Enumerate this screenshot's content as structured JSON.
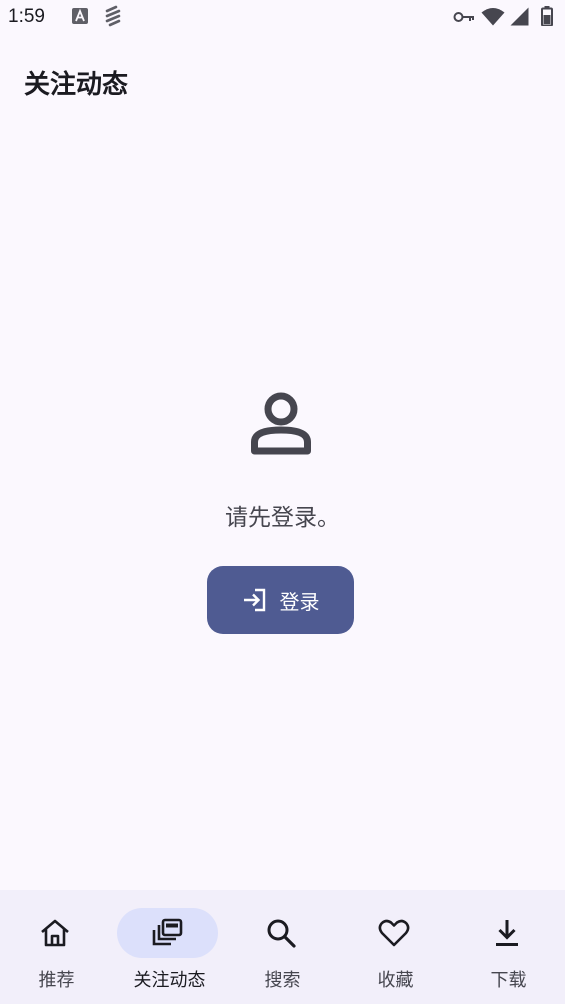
{
  "status_bar": {
    "time": "1:59",
    "icons": [
      "a11y-icon",
      "bolt-icon",
      "key-icon",
      "wifi-icon",
      "signal-icon",
      "battery-icon"
    ]
  },
  "app_bar": {
    "title": "关注动态"
  },
  "empty_state": {
    "icon": "person-icon",
    "message": "请先登录。",
    "login_button": {
      "label": "登录",
      "icon": "login-icon"
    }
  },
  "bottom_nav": {
    "active_index": 1,
    "items": [
      {
        "label": "推荐",
        "icon": "home-icon"
      },
      {
        "label": "关注动态",
        "icon": "subscriptions-icon"
      },
      {
        "label": "搜索",
        "icon": "search-icon"
      },
      {
        "label": "收藏",
        "icon": "heart-icon"
      },
      {
        "label": "下载",
        "icon": "download-icon"
      }
    ]
  },
  "colors": {
    "background": "#fbf8fe",
    "primary": "#4f5b92",
    "nav_background": "#f2effa",
    "active_indicator": "#dce0fb",
    "text": "#1b1b21",
    "secondary_text": "#46464f"
  }
}
